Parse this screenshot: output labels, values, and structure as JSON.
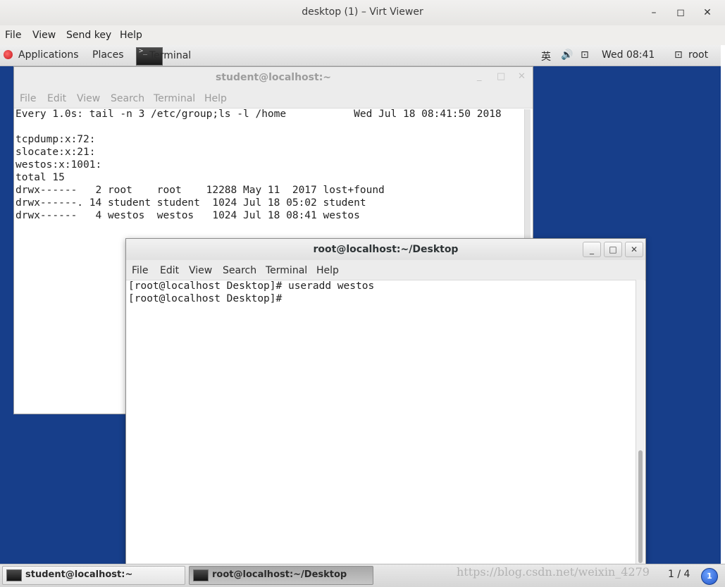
{
  "viewer": {
    "title": "desktop (1) – Virt Viewer",
    "controls": {
      "minimize": "–",
      "maximize": "◻",
      "close": "✕"
    },
    "menu": [
      "File",
      "View",
      "Send key",
      "Help"
    ]
  },
  "panel": {
    "applications": "Applications",
    "places": "Places",
    "terminal_launcher": "Terminal",
    "ime": "英",
    "clock": "Wed 08:41",
    "user": "root"
  },
  "win_student": {
    "title": "student@localhost:~",
    "menu": [
      "File",
      "Edit",
      "View",
      "Search",
      "Terminal",
      "Help"
    ],
    "lines": [
      "Every 1.0s: tail -n 3 /etc/group;ls -l /home           Wed Jul 18 08:41:50 2018",
      "",
      "tcpdump:x:72:",
      "slocate:x:21:",
      "westos:x:1001:",
      "total 15",
      "drwx------   2 root    root    12288 May 11  2017 lost+found",
      "drwx------. 14 student student  1024 Jul 18 05:02 student",
      "drwx------   4 westos  westos   1024 Jul 18 08:41 westos"
    ]
  },
  "win_root": {
    "title": "root@localhost:~/Desktop",
    "menu": [
      "File",
      "Edit",
      "View",
      "Search",
      "Terminal",
      "Help"
    ],
    "lines": [
      "[root@localhost Desktop]# useradd westos",
      "[root@localhost Desktop]# "
    ]
  },
  "taskbar": {
    "tasks": [
      {
        "label": "student@localhost:~",
        "active": false
      },
      {
        "label": "root@localhost:~/Desktop",
        "active": true
      }
    ],
    "watermark": "https://blog.csdn.net/weixin_4279",
    "pager": "1 / 4",
    "notification_count": "1"
  }
}
